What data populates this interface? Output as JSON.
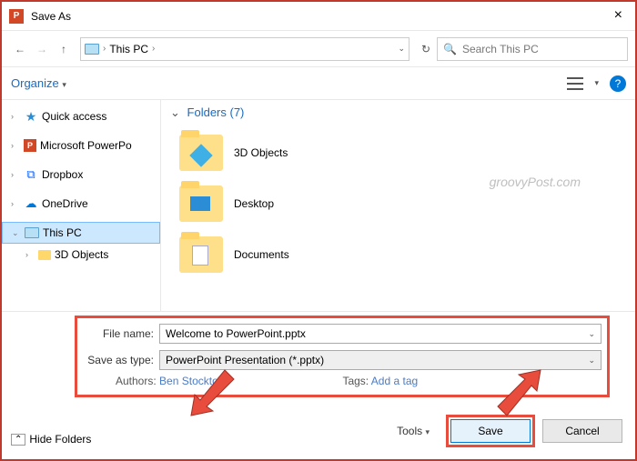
{
  "titlebar": {
    "title": "Save As"
  },
  "nav": {
    "breadcrumb": {
      "location": "This PC",
      "chevron_end": "›"
    },
    "search_placeholder": "Search This PC",
    "dropdown_chev": "⌄",
    "refresh": "↻"
  },
  "toolbar": {
    "organize_label": "Organize",
    "help": "?"
  },
  "sidebar": {
    "items": [
      {
        "label": "Quick access",
        "expandable": true
      },
      {
        "label": "Microsoft PowerPo",
        "expandable": true
      },
      {
        "label": "Dropbox",
        "expandable": true
      },
      {
        "label": "OneDrive",
        "expandable": true
      },
      {
        "label": "This PC",
        "expandable": true,
        "expanded": true,
        "selected": true
      },
      {
        "label": "3D Objects",
        "expandable": true,
        "child": true
      }
    ]
  },
  "main": {
    "folders_header": "Folders (7)",
    "folders": [
      {
        "label": "3D Objects"
      },
      {
        "label": "Desktop"
      },
      {
        "label": "Documents"
      }
    ]
  },
  "watermark": "groovyPost.com",
  "form": {
    "filename_label": "File name:",
    "filename_value": "Welcome to PowerPoint.pptx",
    "savetype_label": "Save as type:",
    "savetype_value": "PowerPoint Presentation (*.pptx)",
    "authors_label": "Authors:",
    "authors_value": "Ben Stockton",
    "tags_label": "Tags:",
    "tags_value": "Add a tag"
  },
  "footer": {
    "hide_folders": "Hide Folders",
    "tools_label": "Tools",
    "save_label": "Save",
    "cancel_label": "Cancel"
  }
}
